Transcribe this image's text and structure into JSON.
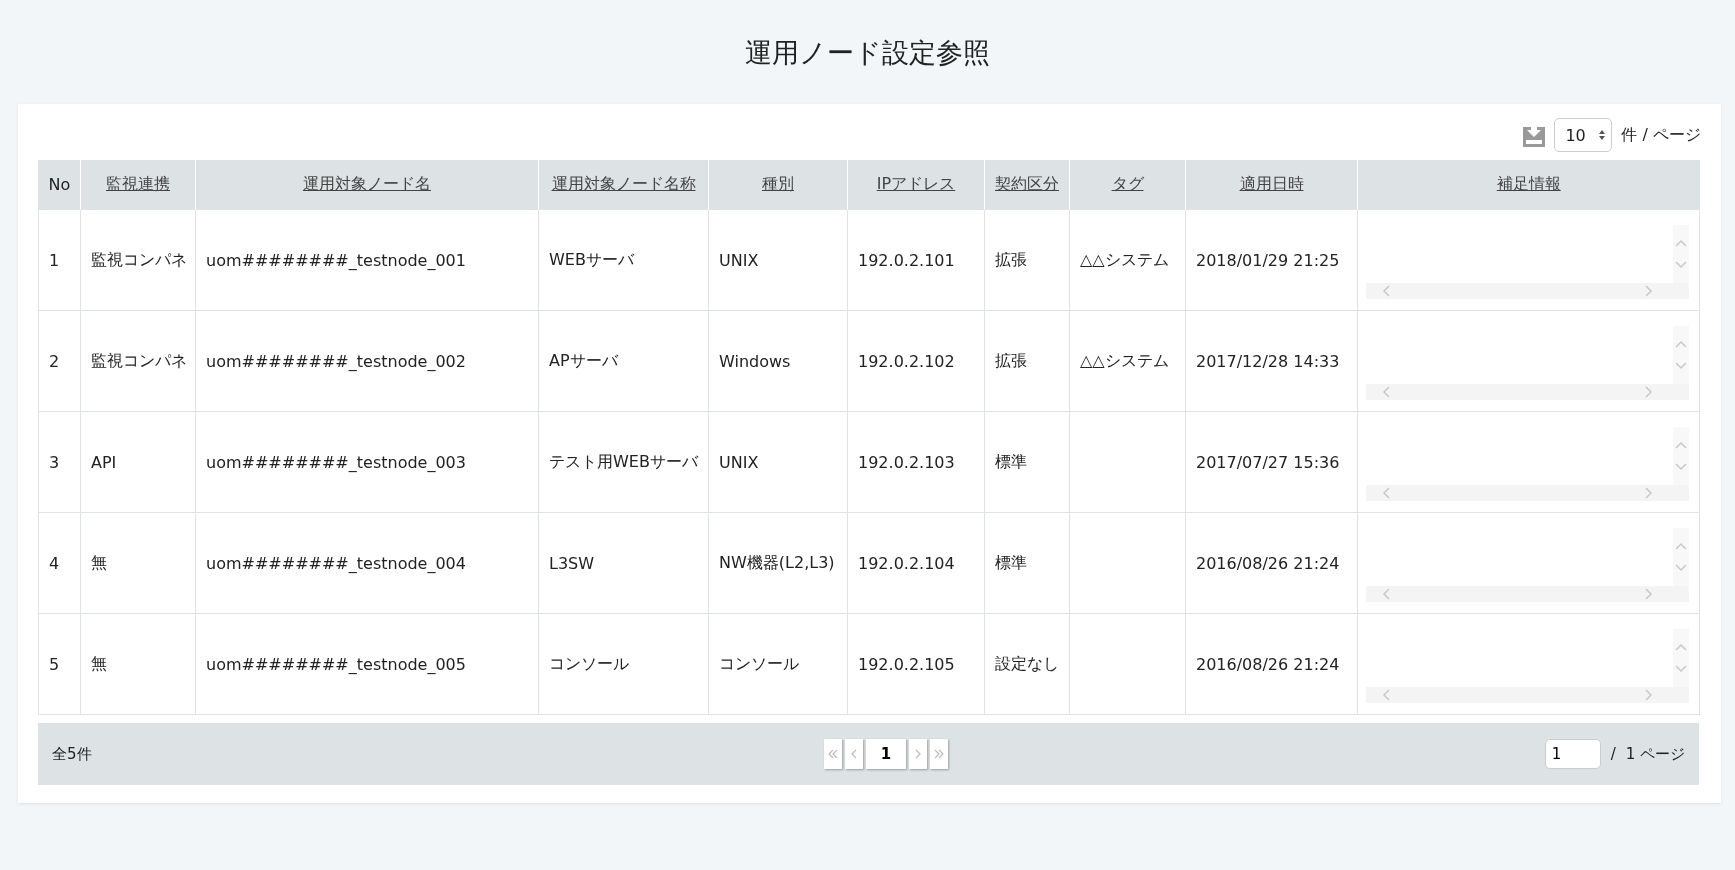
{
  "title": "運用ノード設定参照",
  "toolbar": {
    "per_page": "10",
    "per_page_label": "件 / ページ"
  },
  "table": {
    "columns": [
      {
        "label": "No",
        "sortable": false
      },
      {
        "label": "監視連携",
        "sortable": true
      },
      {
        "label": "運用対象ノード名",
        "sortable": true
      },
      {
        "label": "運用対象ノード名称",
        "sortable": true
      },
      {
        "label": "種別",
        "sortable": true
      },
      {
        "label": "IPアドレス",
        "sortable": true
      },
      {
        "label": "契約区分",
        "sortable": true
      },
      {
        "label": "タグ",
        "sortable": true
      },
      {
        "label": "適用日時",
        "sortable": true
      },
      {
        "label": "補足情報",
        "sortable": true
      }
    ],
    "rows": [
      {
        "cells": [
          "1",
          "監視コンパネ",
          "uom########_testnode_001",
          "WEBサーバ",
          "UNIX",
          "192.0.2.101",
          "拡張",
          "△△システム",
          "2018/01/29 21:25"
        ]
      },
      {
        "cells": [
          "2",
          "監視コンパネ",
          "uom########_testnode_002",
          "APサーバ",
          "Windows",
          "192.0.2.102",
          "拡張",
          "△△システム",
          "2017/12/28 14:33"
        ]
      },
      {
        "cells": [
          "3",
          "API",
          "uom########_testnode_003",
          "テスト用WEBサーバ",
          "UNIX",
          "192.0.2.103",
          "標準",
          "",
          "2017/07/27 15:36"
        ]
      },
      {
        "cells": [
          "4",
          "無",
          "uom########_testnode_004",
          "L3SW",
          "NW機器(L2,L3)",
          "192.0.2.104",
          "標準",
          "",
          "2016/08/26 21:24"
        ]
      },
      {
        "cells": [
          "5",
          "無",
          "uom########_testnode_005",
          "コンソール",
          "コンソール",
          "192.0.2.105",
          "設定なし",
          "",
          "2016/08/26 21:24"
        ]
      }
    ]
  },
  "footer": {
    "total": "全5件",
    "pages": [
      {
        "label": "1",
        "selected": true
      }
    ],
    "page_input": "1",
    "page_separator": "/",
    "page_count": "1 ページ"
  }
}
